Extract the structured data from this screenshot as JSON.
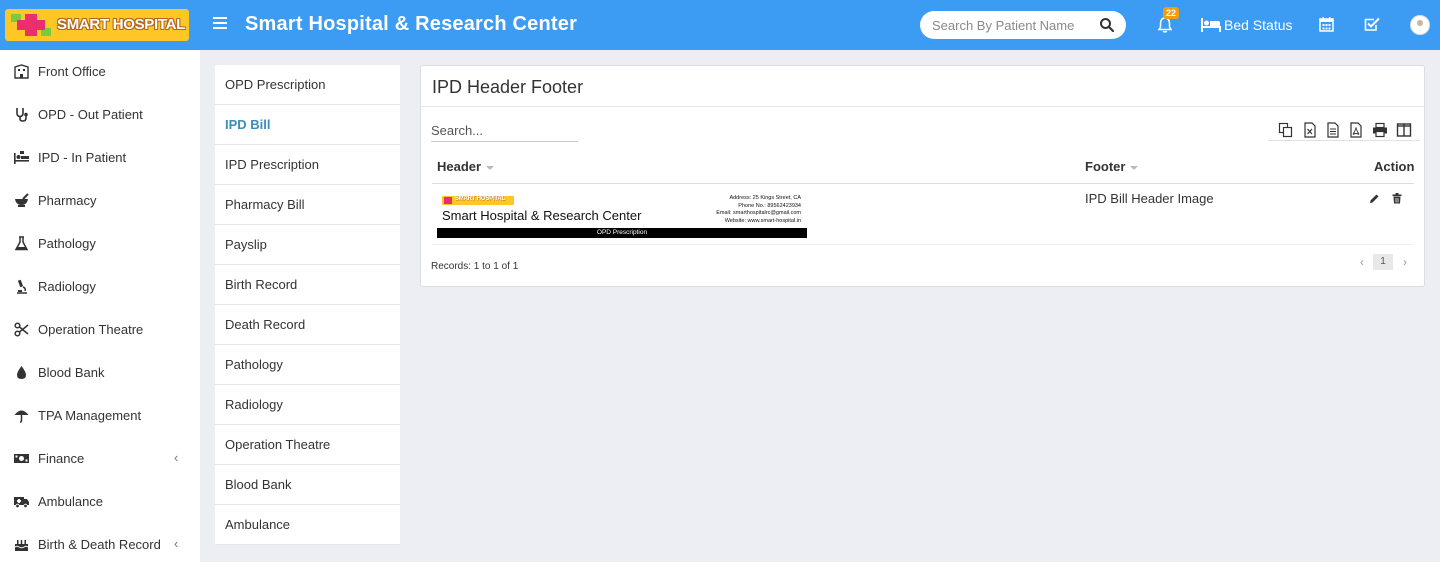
{
  "header": {
    "logo_text": "SMART HOSPITAL",
    "app_title": "Smart Hospital & Research Center",
    "search_placeholder": "Search By Patient Name",
    "notification_count": "22",
    "bed_status_label": "Bed Status",
    "colors": {
      "bar": "#3c9cf3",
      "logo_bg": "#ffc726",
      "logo_cross": "#e92f6d",
      "badge": "#f39c12"
    },
    "icons": [
      "menu-icon",
      "search-icon",
      "bell-icon",
      "bed-icon",
      "calendar-icon",
      "check-square-icon",
      "avatar"
    ]
  },
  "sidebar": {
    "items": [
      {
        "label": "Front Office",
        "icon": "building-icon"
      },
      {
        "label": "OPD - Out Patient",
        "icon": "stethoscope-icon"
      },
      {
        "label": "IPD - In Patient",
        "icon": "procedures-icon"
      },
      {
        "label": "Pharmacy",
        "icon": "mortar-pestle-icon"
      },
      {
        "label": "Pathology",
        "icon": "flask-icon"
      },
      {
        "label": "Radiology",
        "icon": "microscope-icon"
      },
      {
        "label": "Operation Theatre",
        "icon": "scissors-icon"
      },
      {
        "label": "Blood Bank",
        "icon": "drop-icon"
      },
      {
        "label": "TPA Management",
        "icon": "umbrella-icon"
      },
      {
        "label": "Finance",
        "icon": "money-icon",
        "has_submenu": true
      },
      {
        "label": "Ambulance",
        "icon": "ambulance-icon"
      },
      {
        "label": "Birth & Death Record",
        "icon": "birthday-cake-icon",
        "has_submenu": true
      }
    ],
    "chevron": "‹"
  },
  "subnav": {
    "items": [
      {
        "label": "OPD Prescription"
      },
      {
        "label": "IPD Bill",
        "active": true
      },
      {
        "label": "IPD Prescription"
      },
      {
        "label": "Pharmacy Bill"
      },
      {
        "label": "Payslip"
      },
      {
        "label": "Birth Record"
      },
      {
        "label": "Death Record"
      },
      {
        "label": "Pathology"
      },
      {
        "label": "Radiology"
      },
      {
        "label": "Operation Theatre"
      },
      {
        "label": "Blood Bank"
      },
      {
        "label": "Ambulance"
      }
    ]
  },
  "main": {
    "title": "IPD Header Footer",
    "search_placeholder": "Search...",
    "export_tools": [
      "copy-icon",
      "excel-icon",
      "csv-icon",
      "pdf-icon",
      "print-icon",
      "columns-icon"
    ],
    "columns": {
      "header": "Header",
      "footer": "Footer",
      "action": "Action"
    },
    "rows": [
      {
        "header_image": {
          "logo_text": "SMART HOSPITAL",
          "name": "Smart Hospital & Research Center",
          "address_lines": [
            "Address: 25 Kings Street, CA",
            "Phone No.: 89562423934",
            "Email: smarthospitalrc@gmail.com",
            "Website: www.smart-hospital.in"
          ],
          "bar_text": "OPD Prescription"
        },
        "footer": "IPD Bill Header Image",
        "actions": [
          "edit-icon",
          "delete-icon"
        ]
      }
    ],
    "records_text": "Records: 1 to 1 of 1",
    "pagination": {
      "prev": "‹",
      "current": "1",
      "next": "›"
    }
  }
}
